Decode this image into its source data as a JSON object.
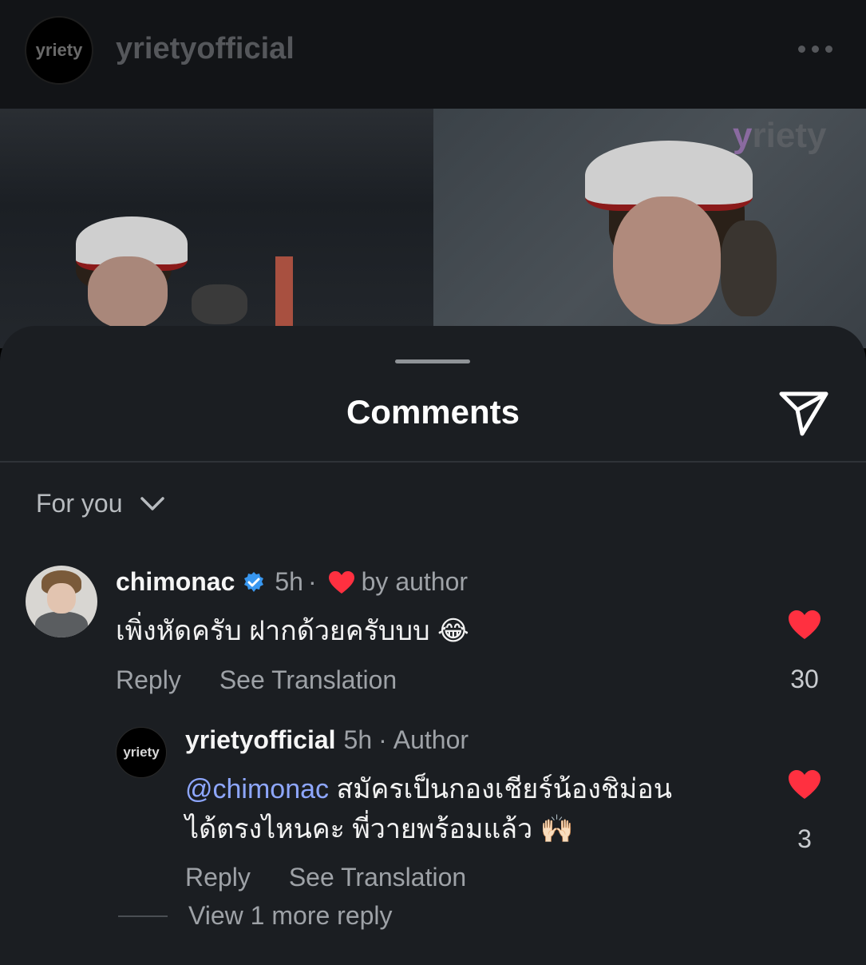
{
  "post": {
    "username": "yrietyofficial",
    "avatar_text": "yriety",
    "brand_watermark": "riety"
  },
  "comments_sheet": {
    "title": "Comments",
    "filter_label": "For you"
  },
  "comments": [
    {
      "username": "chimonac",
      "verified": true,
      "time": "5h",
      "separator": "·",
      "liked_by_author_label": "by author",
      "text": "เพิ่งหัดครับ ฝากด้วยครับบบ 😂",
      "reply_label": "Reply",
      "translate_label": "See Translation",
      "likes": "30"
    }
  ],
  "replies": [
    {
      "username": "yrietyofficial",
      "avatar_text": "yriety",
      "time": "5h",
      "separator": "·",
      "role": "Author",
      "mention": "@chimonac",
      "text_line1": " สมัครเป็นกองเชียร์น้องชิม่อน",
      "text_line2": "ได้ตรงไหนคะ พี่วายพร้อมแล้ว 🙌🏻",
      "reply_label": "Reply",
      "translate_label": "See Translation",
      "likes": "3"
    }
  ],
  "view_more_label": "View 1 more reply",
  "colors": {
    "heart": "#ff3040",
    "verified": "#3897f0",
    "mention": "#8ea7ff",
    "sheet_bg": "#1b1e22"
  }
}
